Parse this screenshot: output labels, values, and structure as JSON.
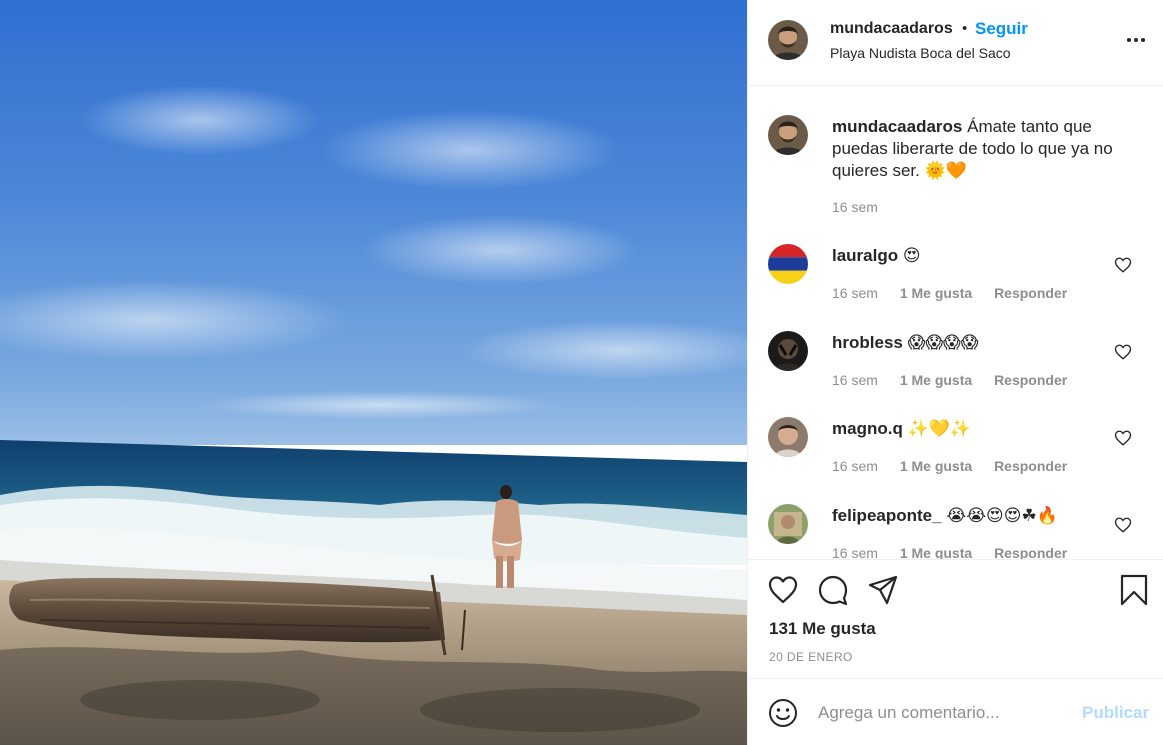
{
  "post": {
    "image_alt": "Beach photo"
  },
  "header": {
    "username": "mundacaadaros",
    "separator": "•",
    "follow_label": "Seguir",
    "location": "Playa Nudista Boca del Saco"
  },
  "caption": {
    "username": "mundacaadaros",
    "text": "Ámate tanto que puedas liberarte de todo lo que ya no quieres ser. 🌞🧡",
    "time": "16 sem"
  },
  "comments": [
    {
      "username": "lauralgo",
      "text": "😍",
      "time": "16 sem",
      "likes": "1 Me gusta",
      "reply": "Responder"
    },
    {
      "username": "hrobless",
      "text": "😱😱😱😱",
      "time": "16 sem",
      "likes": "1 Me gusta",
      "reply": "Responder"
    },
    {
      "username": "magno.q",
      "text": "✨💛✨",
      "time": "16 sem",
      "likes": "1 Me gusta",
      "reply": "Responder"
    },
    {
      "username": "felipeaponte_",
      "text": "😭😭😍😍☘🔥",
      "time": "16 sem",
      "likes": "1 Me gusta",
      "reply": "Responder"
    }
  ],
  "actions": {
    "like_icon": "heart-icon",
    "comment_icon": "comment-icon",
    "share_icon": "paper-plane-icon",
    "save_icon": "bookmark-icon"
  },
  "stats": {
    "likes": "131 Me gusta",
    "date": "20 DE ENERO"
  },
  "comment_input": {
    "placeholder": "Agrega un comentario...",
    "publish_label": "Publicar"
  },
  "colors": {
    "accent": "#0095f6",
    "publish_disabled": "#b3dbff",
    "muted": "#8e8e8e",
    "text": "#262626"
  }
}
